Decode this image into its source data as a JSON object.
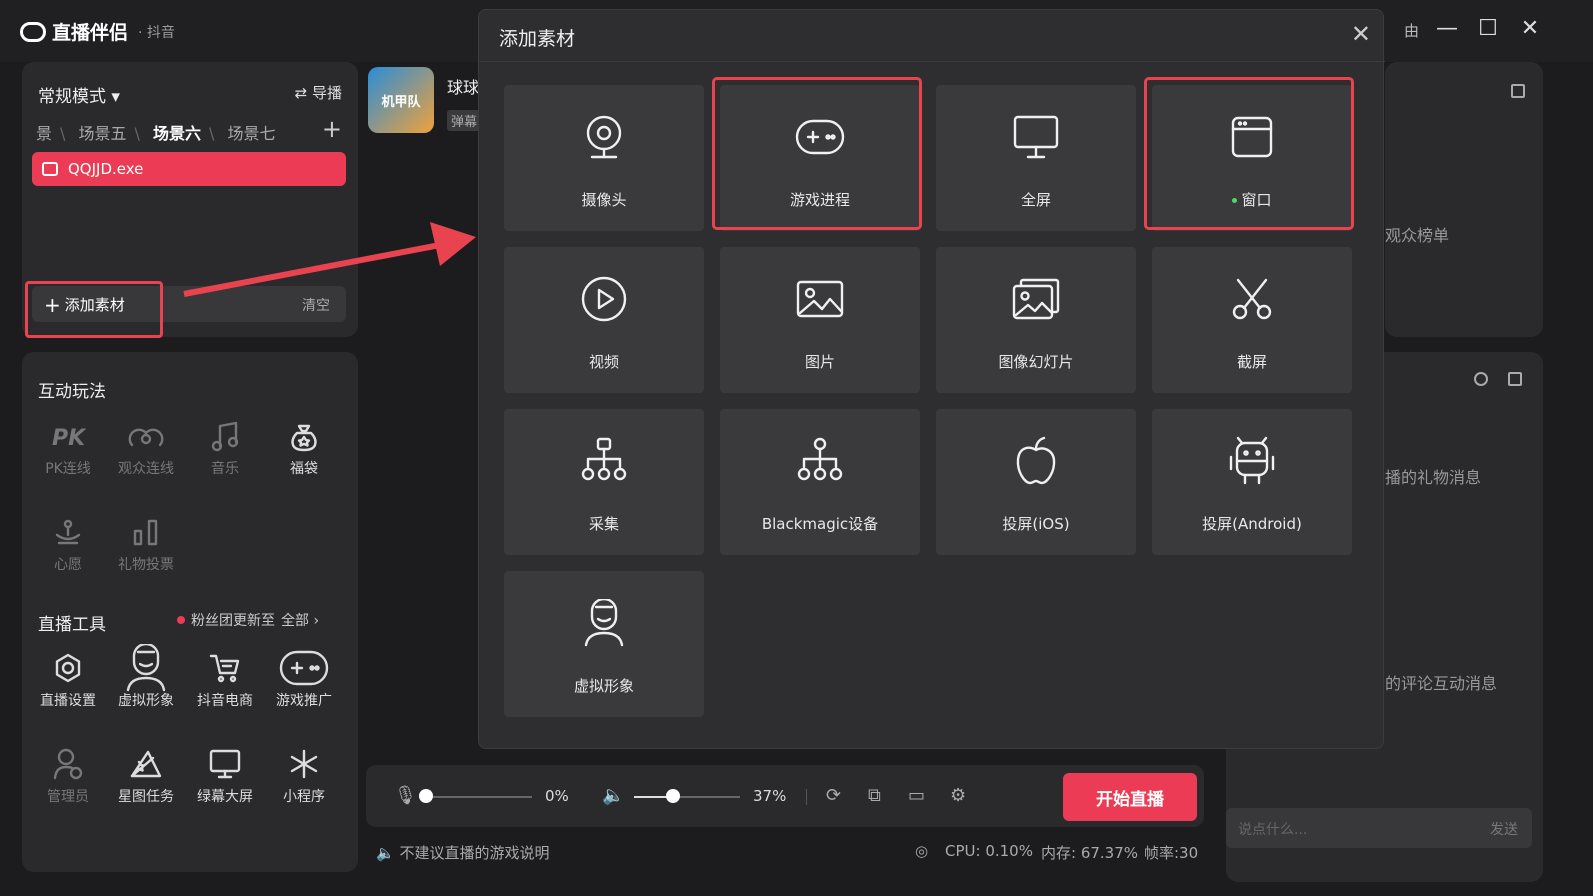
{
  "titlebar": {
    "app_name": "直播伴侣",
    "platform": "· 抖音",
    "partial_text": "由"
  },
  "scene_panel": {
    "mode": "常规模式 ▾",
    "switch_label": "⇄ 导播",
    "scenes": [
      "景",
      "场景五",
      "场景六",
      "场景七"
    ],
    "active_scene": "场景六",
    "source_name": "QQJJD.exe",
    "add_label": "添加素材",
    "clear_label": "清空"
  },
  "interactive": {
    "title": "互动玩法",
    "items": [
      {
        "label": "PK连线",
        "icon": "pk-icon",
        "enabled": false
      },
      {
        "label": "观众连线",
        "icon": "audience-link-icon",
        "enabled": false
      },
      {
        "label": "音乐",
        "icon": "music-icon",
        "enabled": false
      },
      {
        "label": "福袋",
        "icon": "lucky-bag-icon",
        "enabled": true
      },
      {
        "label": "心愿",
        "icon": "wish-icon",
        "enabled": false
      },
      {
        "label": "礼物投票",
        "icon": "gift-vote-icon",
        "enabled": false
      }
    ]
  },
  "tools": {
    "title": "直播工具",
    "update_text": "粉丝团更新至",
    "all_label": "全部 ›",
    "items": [
      {
        "label": "直播设置",
        "icon": "settings-icon",
        "enabled": true
      },
      {
        "label": "虚拟形象",
        "icon": "avatar-icon",
        "enabled": true
      },
      {
        "label": "抖音电商",
        "icon": "cart-icon",
        "enabled": true
      },
      {
        "label": "游戏推广",
        "icon": "gamepad-icon",
        "enabled": true
      },
      {
        "label": "管理员",
        "icon": "admin-icon",
        "enabled": false
      },
      {
        "label": "星图任务",
        "icon": "star-task-icon",
        "enabled": true
      },
      {
        "label": "绿幕大屏",
        "icon": "green-screen-icon",
        "enabled": true
      },
      {
        "label": "小程序",
        "icon": "mini-program-icon",
        "enabled": true
      }
    ]
  },
  "game": {
    "name": "球球",
    "tag": "弹幕",
    "thumb_text": "机甲队"
  },
  "audio": {
    "mic_percent": "0%",
    "mic_level": 0,
    "speaker_percent": "37%",
    "speaker_level": 0.37
  },
  "start_button": "开始直播",
  "status": {
    "tip": "不建议直播的游戏说明",
    "cpu": "CPU: 0.10%",
    "memory": "内存: 67.37%",
    "fps": "帧率:30"
  },
  "right": {
    "audience_rank": "观众榜单",
    "gift_msg": "播的礼物消息",
    "comment_msg": "的评论互动消息",
    "chat_placeholder": "说点什么...",
    "send_label": "发送"
  },
  "dialog": {
    "title": "添加素材",
    "tiles": [
      {
        "label": "摄像头",
        "icon": "camera-icon",
        "highlighted": false,
        "dot": false
      },
      {
        "label": "游戏进程",
        "icon": "gamepad-icon",
        "highlighted": true,
        "dot": false
      },
      {
        "label": "全屏",
        "icon": "monitor-icon",
        "highlighted": false,
        "dot": false
      },
      {
        "label": "窗口",
        "icon": "window-icon",
        "highlighted": true,
        "dot": true
      },
      {
        "label": "视频",
        "icon": "play-icon",
        "highlighted": false,
        "dot": false
      },
      {
        "label": "图片",
        "icon": "image-icon",
        "highlighted": false,
        "dot": false
      },
      {
        "label": "图像幻灯片",
        "icon": "slideshow-icon",
        "highlighted": false,
        "dot": false
      },
      {
        "label": "截屏",
        "icon": "scissors-icon",
        "highlighted": false,
        "dot": false
      },
      {
        "label": "采集",
        "icon": "capture-tree-icon",
        "highlighted": false,
        "dot": false
      },
      {
        "label": "Blackmagic设备",
        "icon": "blackmagic-tree-icon",
        "highlighted": false,
        "dot": false
      },
      {
        "label": "投屏(iOS)",
        "icon": "apple-icon",
        "highlighted": false,
        "dot": false
      },
      {
        "label": "投屏(Android)",
        "icon": "android-icon",
        "highlighted": false,
        "dot": false
      },
      {
        "label": "虚拟形象",
        "icon": "avatar-icon",
        "highlighted": false,
        "dot": false
      }
    ]
  },
  "colors": {
    "accent": "#ec3c55",
    "highlight": "#e8434f",
    "dialog_bg": "#2e2e30",
    "tile_bg": "#3a3a3c"
  }
}
